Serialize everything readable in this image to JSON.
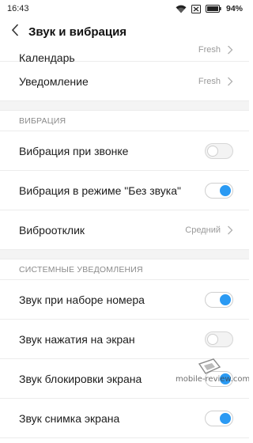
{
  "status_bar": {
    "time": "16:43",
    "battery": "94%",
    "icons": [
      "wifi-icon",
      "sim-disabled-icon",
      "battery-icon"
    ]
  },
  "header": {
    "title": "Звук и вибрация",
    "back_icon": "chevron-left-icon"
  },
  "rows_top": [
    {
      "label": "Календарь",
      "value": "Fresh"
    },
    {
      "label": "Уведомление",
      "value": "Fresh"
    }
  ],
  "section_vibration": {
    "header": "ВИБРАЦИЯ",
    "rows": [
      {
        "label": "Вибрация при звонке",
        "toggle": false
      },
      {
        "label": "Вибрация в режиме \"Без звука\"",
        "toggle": true
      },
      {
        "label": "Виброотклик",
        "value": "Средний"
      }
    ]
  },
  "section_system": {
    "header": "СИСТЕМНЫЕ УВЕДОМЛЕНИЯ",
    "rows": [
      {
        "label": "Звук при наборе номера",
        "toggle": true
      },
      {
        "label": "Звук нажатия на экран",
        "toggle": false
      },
      {
        "label": "Звук блокировки экрана",
        "toggle": true
      },
      {
        "label": "Звук снимка экрана",
        "toggle": true
      }
    ]
  },
  "watermark": {
    "text": "mobile-review.com"
  },
  "colors": {
    "accent": "#2b9af3",
    "section_bg": "#f4f4f4",
    "divider": "#ececec"
  }
}
